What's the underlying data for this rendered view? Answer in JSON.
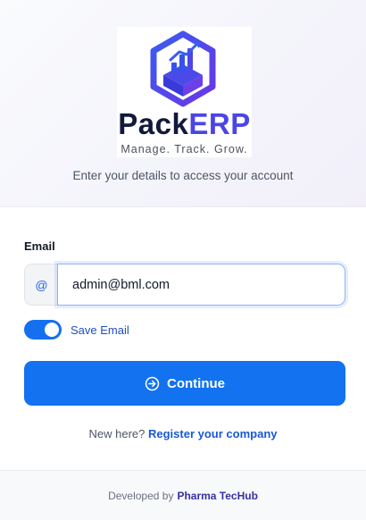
{
  "header": {
    "brand_part1": "Pack",
    "brand_part2": "ERP",
    "tagline": "Manage. Track. Grow.",
    "subtitle": "Enter your details to access your account"
  },
  "form": {
    "email_label": "Email",
    "email_addon": "@",
    "email_value": "admin@bml.com",
    "save_email_label": "Save Email",
    "save_email_checked": true,
    "continue_label": "Continue"
  },
  "register": {
    "prefix": "New here?",
    "link_label": "Register your company"
  },
  "footer": {
    "prefix": "Developed by",
    "company": "Pharma TecHub"
  },
  "colors": {
    "primary": "#1272ef",
    "brand_navy": "#121a3a",
    "brand_purple": "#4b45e6",
    "link_blue": "#1759d6"
  },
  "icons": {
    "logo": "packerp-logo-icon",
    "continue": "arrow-right-circle-icon"
  }
}
